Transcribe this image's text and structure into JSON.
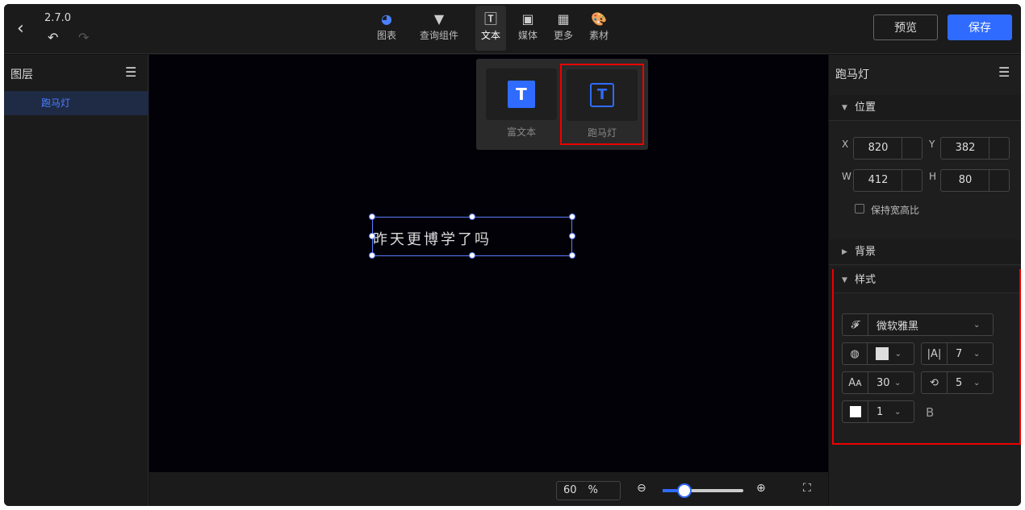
{
  "app": {
    "version": "2.7.0"
  },
  "toolbar": {
    "chart": "图表",
    "query": "查询组件",
    "text": "文本",
    "media": "媒体",
    "more": "更多",
    "assets": "素材"
  },
  "header": {
    "preview": "预览",
    "save": "保存"
  },
  "popup": {
    "richtext": "富文本",
    "marquee": "跑马灯"
  },
  "layers": {
    "title": "图层",
    "items": [
      "跑马灯"
    ]
  },
  "canvas": {
    "text": "昨天更博学了吗"
  },
  "zoom": {
    "value": "60",
    "unit": "%"
  },
  "props": {
    "title": "跑马灯",
    "position": {
      "title": "位置",
      "x": "820",
      "y": "382",
      "w": "412",
      "h": "80",
      "keep_ratio": "保持宽高比",
      "x_label": "X",
      "y_label": "Y",
      "w_label": "W",
      "h_label": "H"
    },
    "background": "背景",
    "style": {
      "title": "样式",
      "font": "微软雅黑",
      "letter": "7",
      "size": "30",
      "speed": "5",
      "stroke": "1",
      "bold": "B"
    }
  }
}
